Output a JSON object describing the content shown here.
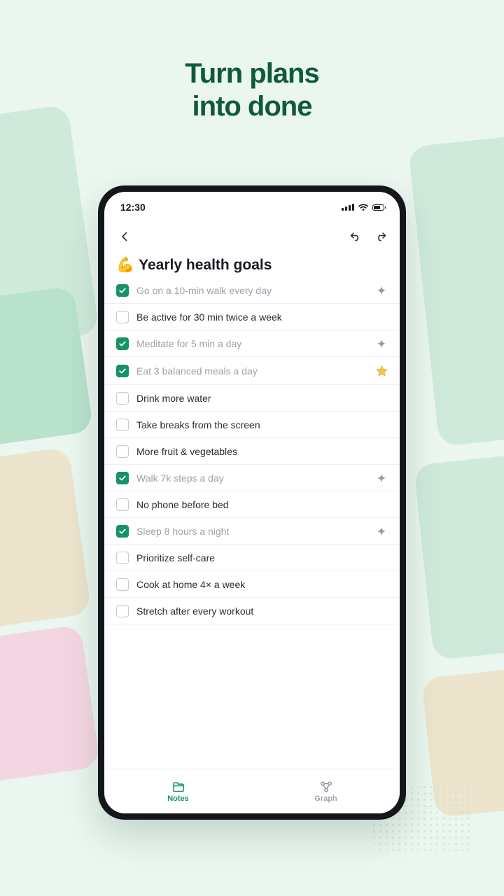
{
  "headline": {
    "line1": "Turn plans",
    "line2": "into done"
  },
  "status_bar": {
    "time": "12:30"
  },
  "note": {
    "emoji": "💪",
    "title": "Yearly health goals"
  },
  "items": [
    {
      "label": "Go on a 10-min walk every day",
      "checked": true,
      "mark": "sparkle-icon"
    },
    {
      "label": "Be active for 30 min twice a week",
      "checked": false,
      "mark": ""
    },
    {
      "label": "Meditate for 5 min a day",
      "checked": true,
      "mark": "sparkle-icon"
    },
    {
      "label": "Eat 3 balanced meals a day",
      "checked": true,
      "mark": "star-icon"
    },
    {
      "label": "Drink more water",
      "checked": false,
      "mark": ""
    },
    {
      "label": "Take breaks from the screen",
      "checked": false,
      "mark": ""
    },
    {
      "label": "More fruit & vegetables",
      "checked": false,
      "mark": ""
    },
    {
      "label": "Walk 7k steps a day",
      "checked": true,
      "mark": "sparkle-icon"
    },
    {
      "label": "No phone before bed",
      "checked": false,
      "mark": ""
    },
    {
      "label": "Sleep 8 hours a night",
      "checked": true,
      "mark": "sparkle-icon"
    },
    {
      "label": "Prioritize self-care",
      "checked": false,
      "mark": ""
    },
    {
      "label": "Cook at home 4× a week",
      "checked": false,
      "mark": ""
    },
    {
      "label": "Stretch after every workout",
      "checked": false,
      "mark": ""
    }
  ],
  "bottom_nav": {
    "notes_label": "Notes",
    "graph_label": "Graph"
  },
  "colors": {
    "accent": "#169364",
    "headline": "#0f5a3a",
    "background": "#eaf6ef"
  }
}
